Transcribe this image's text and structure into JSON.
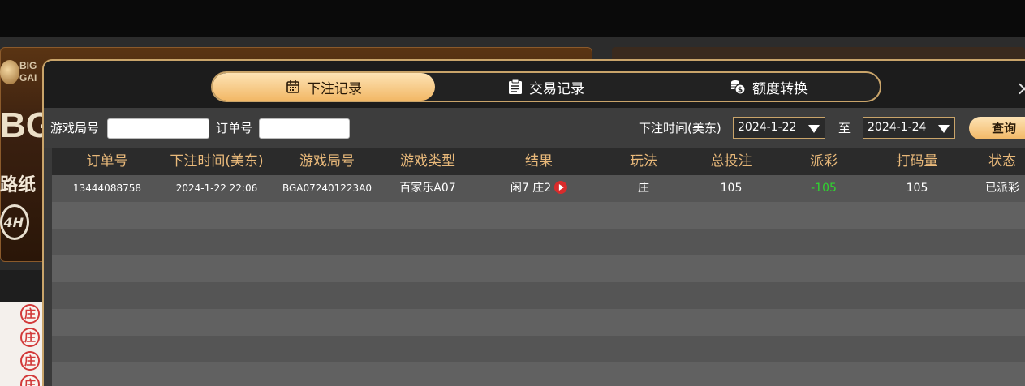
{
  "background": {
    "logo_text": [
      "BIG",
      "GAI"
    ],
    "big_text": "BG",
    "sub_text": "路纸",
    "badge_text": "4H",
    "road_label": "庄"
  },
  "tabs": [
    {
      "label": "下注记录",
      "icon": "calendar-icon",
      "active": true
    },
    {
      "label": "交易记录",
      "icon": "clipboard-icon",
      "active": false
    },
    {
      "label": "额度转换",
      "icon": "coins-icon",
      "active": false
    }
  ],
  "close_label": "×",
  "filters": {
    "game_round_label": "游戏局号",
    "game_round_value": "",
    "order_no_label": "订单号",
    "order_no_value": "",
    "bet_time_label": "下注时间(美东)",
    "date_from": "2024-1-22",
    "to_label": "至",
    "date_to": "2024-1-24",
    "query_label": "查询"
  },
  "table": {
    "headers": [
      "订单号",
      "下注时间(美东)",
      "游戏局号",
      "游戏类型",
      "结果",
      "玩法",
      "总投注",
      "派彩",
      "打码量",
      "状态"
    ],
    "rows": [
      {
        "order_no": "13444088758",
        "bet_time": "2024-1-22 22:06",
        "game_round": "BGA072401223A0",
        "game_type": "百家乐A07",
        "result": "闲7 庄2",
        "play": "庄",
        "total_bet": "105",
        "payout": "-105",
        "turnover": "105",
        "status": "已派彩"
      }
    ],
    "empty_rows": 7
  },
  "colors": {
    "accent_gold": "#c9a46a",
    "header_text": "#e9b97a",
    "negative": "#2fd52f"
  }
}
